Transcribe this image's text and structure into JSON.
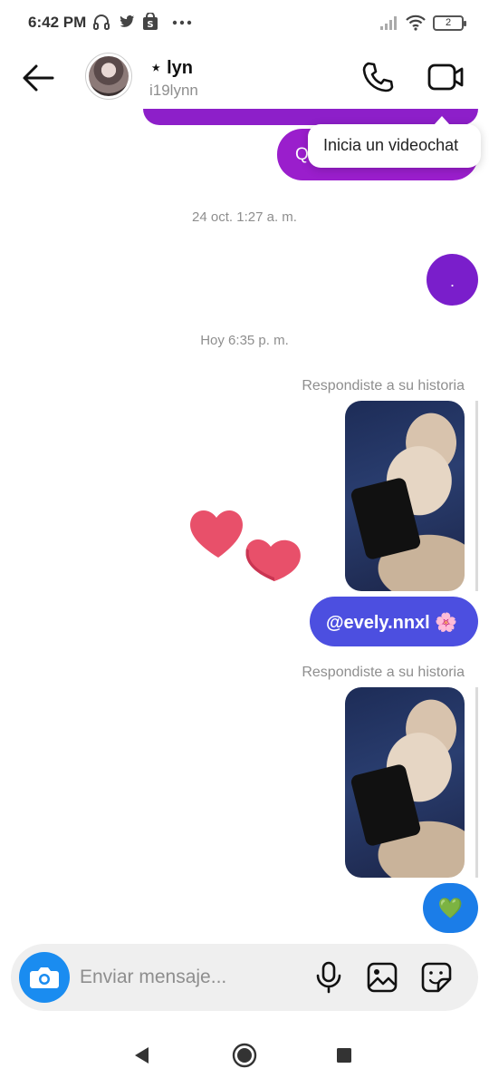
{
  "status_bar": {
    "time": "6:42 PM",
    "battery_level": "2",
    "icons": [
      "headphones-icon",
      "twitter-icon",
      "shopping-bag-icon",
      "more-dots-icon",
      "signal-icon",
      "wifi-icon",
      "battery-icon"
    ]
  },
  "header": {
    "contact_name": "⋆ lyn",
    "username": "i19lynn",
    "icons": [
      "back-arrow-icon",
      "phone-icon",
      "video-camera-icon"
    ]
  },
  "messages": {
    "partial_bubble_text": "Q",
    "tooltip_text": "Inicia un videochat",
    "timestamp_1": "24 oct. 1:27 a. m.",
    "dot_message": ".",
    "timestamp_2": "Hoy 6:35 p. m.",
    "story_reply_label_1": "Respondiste a su historia",
    "story_reply_label_2": "Respondiste a su historia",
    "mention_text": "@evely.nnxl 🌸",
    "heart_emoji": "💚"
  },
  "composer": {
    "placeholder": "Enviar mensaje...",
    "value": "",
    "icons": [
      "camera-icon",
      "microphone-icon",
      "gallery-icon",
      "sticker-icon"
    ]
  },
  "colors": {
    "purple_bubble": "#9a1ecc",
    "blue_bubble": "#4c4fe0",
    "camera_blue": "#1a8cf0",
    "heart_red": "#e8506a"
  }
}
